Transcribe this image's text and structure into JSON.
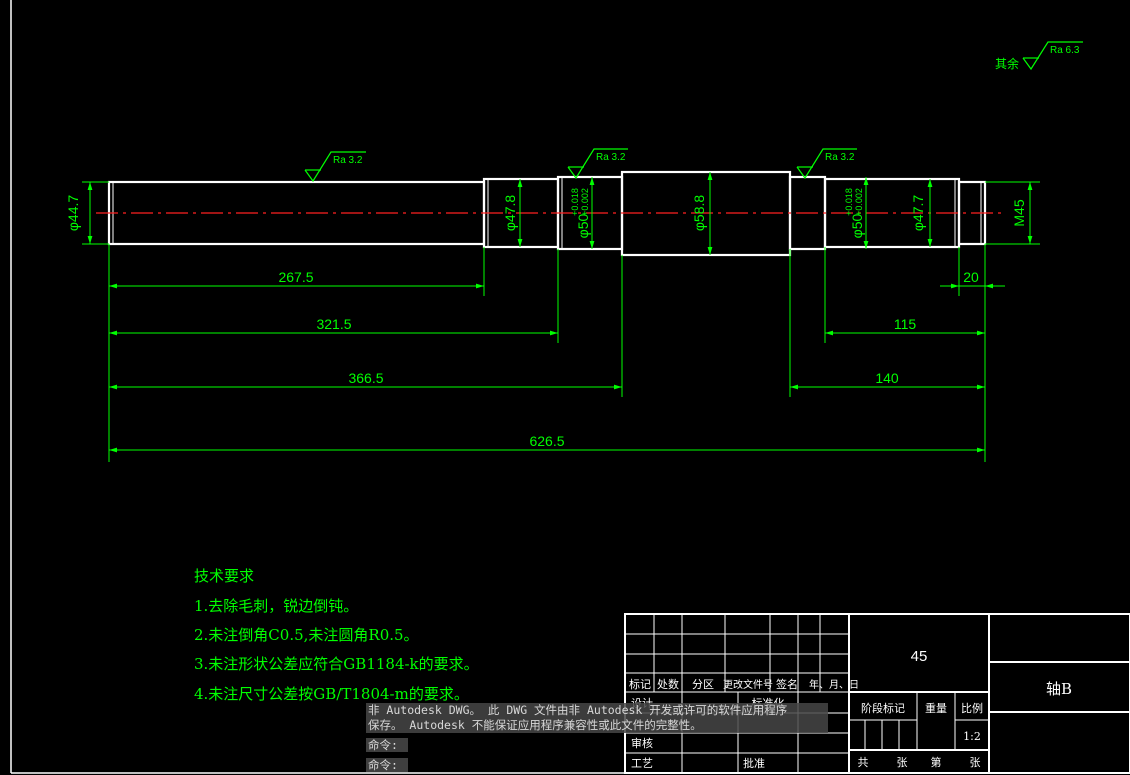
{
  "colors": {
    "background": "#000000",
    "outline": "#ffffff",
    "dimension": "#00ff00",
    "centerline": "#ff2020",
    "notes": "#00ff00"
  },
  "icons": [
    "roughness-symbol-icon"
  ],
  "roughness": {
    "other_label": "其余",
    "other": "Ra 6.3",
    "left_shaft": "Ra 3.2",
    "left_journal": "Ra 3.2",
    "right_journal": "Ra 3.2"
  },
  "diameters": {
    "d1": "φ44.7",
    "d2": "φ47.8",
    "d3_base": "φ50",
    "d3_tol_upper": "+0.018",
    "d3_tol_lower": "+0.002",
    "d4": "φ58.8",
    "d5_base": "φ50",
    "d5_tol_upper": "+0.018",
    "d5_tol_lower": "+0.002",
    "d6": "φ47.7",
    "thread": "M45"
  },
  "lengths": {
    "l1": "267.5",
    "l2": "321.5",
    "l3": "366.5",
    "l4": "626.5",
    "r1": "20",
    "r2": "115",
    "r3": "140"
  },
  "notes": {
    "title": "技术要求",
    "items": [
      "1.去除毛刺，锐边倒钝。",
      "2.未注倒角C0.5,未注圆角R0.5。",
      "3.未注形状公差应符合GB1184-k的要求。",
      "4.未注尺寸公差按GB/T1804-m的要求。"
    ]
  },
  "title_block": {
    "material": "45",
    "part_name": "轴B",
    "revision_headers": [
      "标记",
      "处数",
      "分区",
      "更改文件号",
      "签名",
      "年、月、日"
    ],
    "design": "设计",
    "standardize": "标准化",
    "review": "审核",
    "process": "工艺",
    "approve": "批准",
    "stage_mark": "阶段标记",
    "weight": "重量",
    "scale_label": "比例",
    "scale": "1:2",
    "total": "共",
    "sheets": "张",
    "sheet_no": "第"
  },
  "warning": {
    "line1": "非 Autodesk DWG。  此 DWG 文件由非 Autodesk 开发或许可的软件应用程序",
    "line2": "保存。 Autodesk 不能保证应用程序兼容性或此文件的完整性。"
  },
  "command_prompt": "命令:"
}
